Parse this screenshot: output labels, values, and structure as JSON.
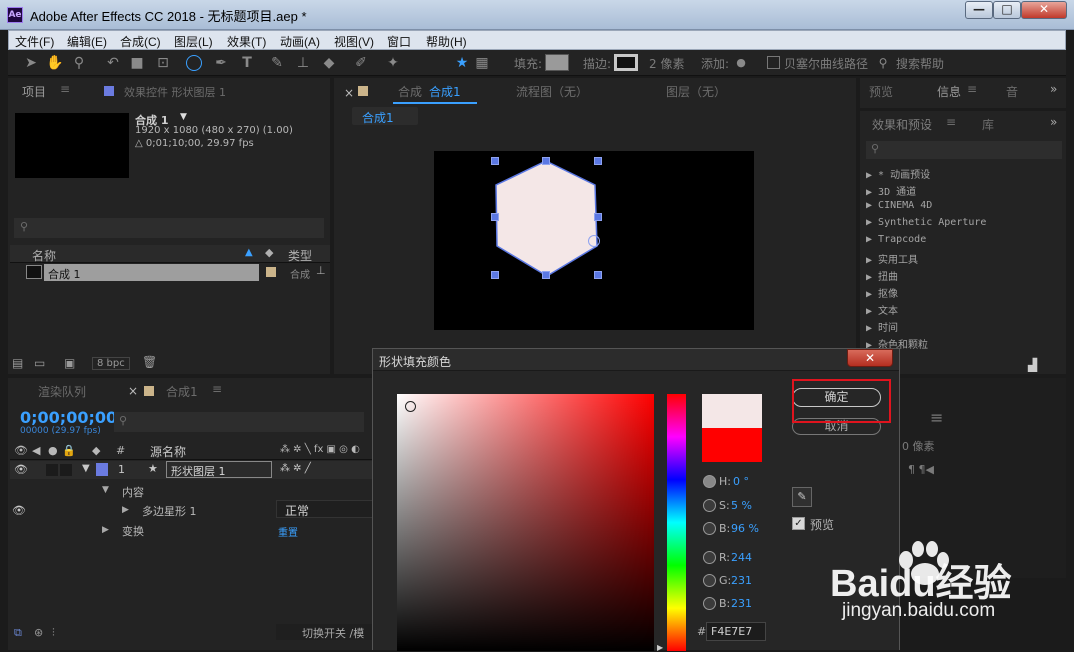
{
  "window": {
    "app_icon": "Ae",
    "title": "Adobe After Effects CC 2018 - 无标题项目.aep *",
    "minimize": "—",
    "maximize": "□",
    "close": "✕"
  },
  "menu": [
    "文件(F)",
    "编辑(E)",
    "合成(C)",
    "图层(L)",
    "效果(T)",
    "动画(A)",
    "视图(V)",
    "窗口",
    "帮助(H)"
  ],
  "toolbar": {
    "fill_label": "填充:",
    "stroke_label": "描边:",
    "stroke_width": "2 像素",
    "add_label": "添加:",
    "bezier_label": "贝塞尔曲线路径",
    "search_help": "搜索帮助"
  },
  "project": {
    "tab_label": "项目",
    "effects_tab": "效果控件 形状图层 1",
    "comp_name": "合成 1",
    "comp_dims": "1920 x 1080  (480 x 270) (1.00)",
    "comp_duration": "△ 0;01;10;00, 29.97 fps",
    "col_name": "名称",
    "col_type": "类型",
    "row_name": "合成 1",
    "row_type": "合成",
    "bpc": "8 bpc"
  },
  "viewer": {
    "comp_tab_prefix": "合成",
    "comp_tab_name": "合成1",
    "flowchart_tab": "流程图（无）",
    "layer_tab": "图层（无）",
    "sub_tab": "合成1"
  },
  "right_panel": {
    "tab_preview": "预览",
    "tab_info": "信息",
    "tab_audio": "音",
    "effects_tab": "效果和预设",
    "library_tab": "库",
    "items": [
      "* 动画预设",
      "3D 通道",
      "CINEMA 4D",
      "Synthetic Aperture",
      "Trapcode",
      "实用工具",
      "扭曲",
      "抠像",
      "文本",
      "时间",
      "杂色和颗粒"
    ]
  },
  "timeline": {
    "render_tab": "渲染队列",
    "comp_tab": "合成1",
    "timecode": "0;00;00;00",
    "frames": "00000 (29.97 fps)",
    "col_hash": "#",
    "col_source": "源名称",
    "layer_num": "1",
    "layer_name": "形状图层 1",
    "content_label": "内容",
    "polystar_label": "多边星形 1",
    "blend_mode": "正常",
    "transform_label": "变换",
    "reset_label": "重置",
    "toggle_label": "切换开关 /模",
    "right_value": "0 像素"
  },
  "dialog": {
    "title": "形状填充颜色",
    "ok_button": "确定",
    "cancel_button": "取消",
    "h_label": "H:",
    "h_value": "0 °",
    "s_label": "S:",
    "s_value": "5 %",
    "b_label": "B:",
    "b_value": "96 %",
    "r_label": "R:",
    "r_value": "244",
    "g_label": "G:",
    "g_value": "231",
    "bl_label": "B:",
    "bl_value": "231",
    "hex_label": "#",
    "hex_value": "F4E7E7",
    "preview_label": "预览",
    "new_color": "#F4E7E7",
    "old_color": "#FF0000"
  },
  "watermark": {
    "brand": "Baidu经验",
    "url": "jingyan.baidu.com"
  },
  "colors": {
    "accent": "#3aa0ff",
    "shape_fill": "#F4E7E7",
    "shape_stroke": "#5b78e3",
    "highlight_box": "#e0141e"
  }
}
